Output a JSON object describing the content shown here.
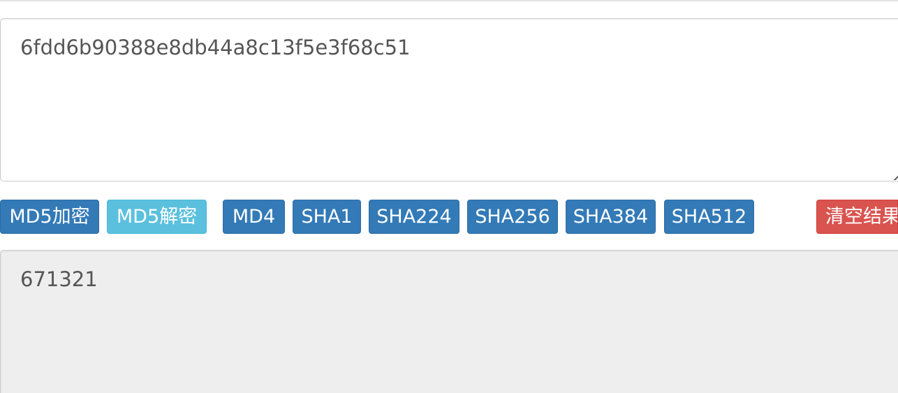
{
  "input": {
    "value": "6fdd6b90388e8db44a8c13f5e3f68c51"
  },
  "toolbar": {
    "md5_encrypt": "MD5加密",
    "md5_decrypt": "MD5解密",
    "md4": "MD4",
    "sha1": "SHA1",
    "sha224": "SHA224",
    "sha256": "SHA256",
    "sha384": "SHA384",
    "sha512": "SHA512",
    "clear_result": "清空结果"
  },
  "result": {
    "value": "671321"
  },
  "colors": {
    "primary": "#337ab7",
    "info": "#5bc0de",
    "danger": "#d9534f",
    "readonly_bg": "#eeeeee",
    "text": "#555555"
  }
}
